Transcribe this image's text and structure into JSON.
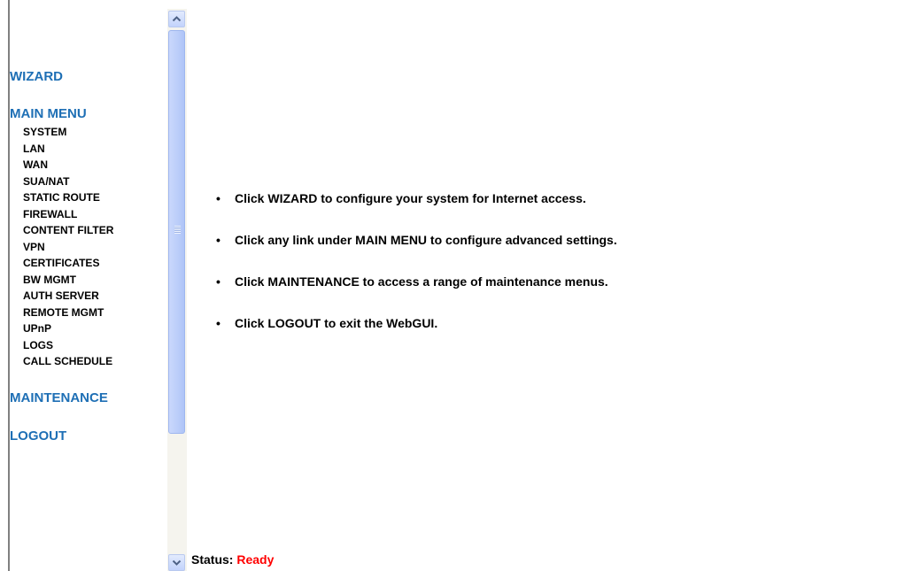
{
  "sidebar": {
    "wizard_label": "WIZARD",
    "main_menu_label": "MAIN MENU",
    "items": [
      {
        "label": "SYSTEM"
      },
      {
        "label": "LAN"
      },
      {
        "label": "WAN"
      },
      {
        "label": "SUA/NAT"
      },
      {
        "label": "STATIC ROUTE"
      },
      {
        "label": "FIREWALL"
      },
      {
        "label": "CONTENT FILTER"
      },
      {
        "label": "VPN"
      },
      {
        "label": "CERTIFICATES"
      },
      {
        "label": "BW MGMT"
      },
      {
        "label": "AUTH SERVER"
      },
      {
        "label": "REMOTE MGMT"
      },
      {
        "label": "UPnP"
      },
      {
        "label": "LOGS"
      },
      {
        "label": "CALL SCHEDULE"
      }
    ],
    "maintenance_label": "MAINTENANCE",
    "logout_label": "LOGOUT"
  },
  "main": {
    "bullet": "•",
    "instructions": [
      "Click WIZARD to configure your system for Internet access.",
      "Click any link under MAIN MENU to configure advanced settings.",
      "Click MAINTENANCE to access a range of maintenance menus.",
      "Click LOGOUT to exit the WebGUI."
    ]
  },
  "status": {
    "label": "Status:",
    "value": "Ready"
  },
  "colors": {
    "link": "#1e6fb5",
    "status_value": "#ff0000"
  },
  "icons": {
    "scroll_up": "chevron-up-icon",
    "scroll_down": "chevron-down-icon"
  }
}
